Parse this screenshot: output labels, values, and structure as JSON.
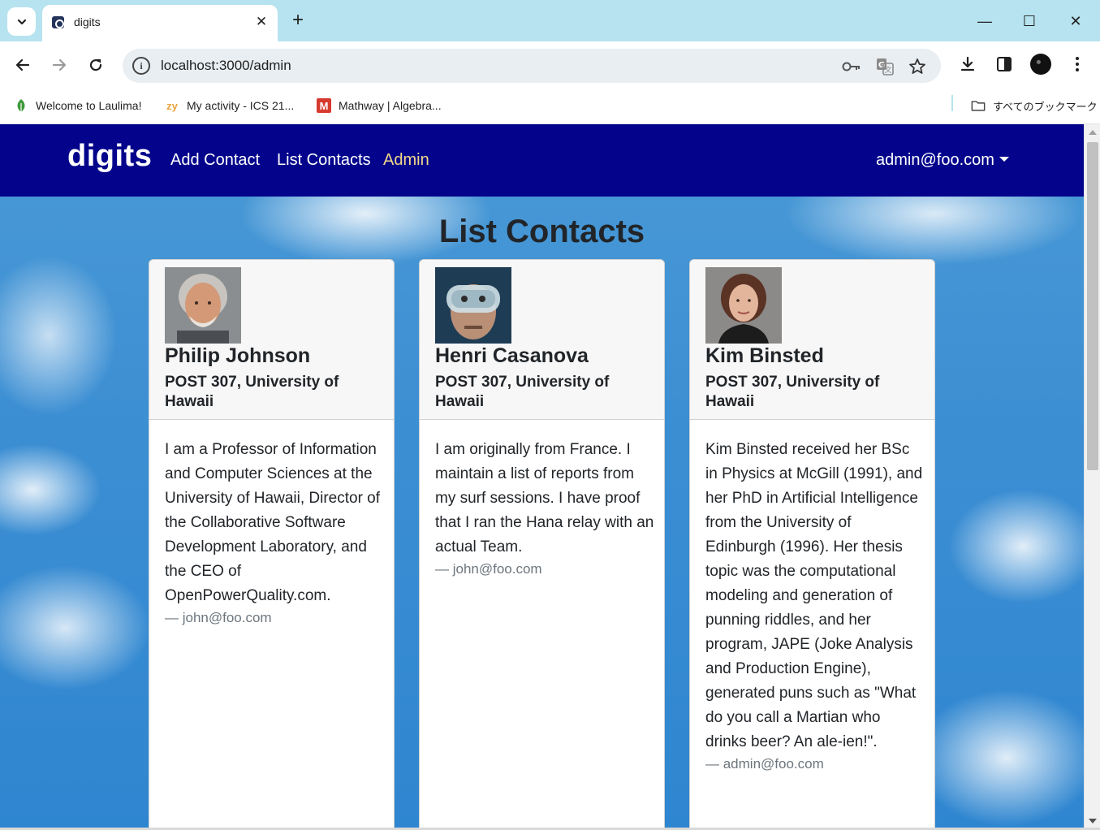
{
  "browser": {
    "tab_title": "digits",
    "tab_close": "✕",
    "new_tab": "+",
    "url": "localhost:3000/admin",
    "info_icon": "i",
    "window_controls": {
      "minimize": "—",
      "maximize": "☐",
      "close": "✕"
    },
    "bookmarks": [
      {
        "label": "Welcome to Laulima!",
        "icon": "leaf-icon"
      },
      {
        "label": "My activity - ICS 21...",
        "icon": "zy",
        "icon_color": "#e8a33d"
      },
      {
        "label": "Mathway | Algebra...",
        "icon": "M",
        "icon_color": "#d63a2f"
      }
    ],
    "all_bookmarks": "すべてのブックマーク"
  },
  "navbar": {
    "brand": "digits",
    "links": [
      "Add Contact",
      "List Contacts",
      "Admin"
    ],
    "active_link": "Admin",
    "user": "admin@foo.com",
    "background": "#03038b",
    "active_color": "#f5d98a"
  },
  "page": {
    "title": "List Contacts"
  },
  "contacts": [
    {
      "name": "Philip Johnson",
      "address": "POST 307, University of Hawaii",
      "description": "I am a Professor of Information and Computer Sciences at the University of Hawaii, Director of the Collaborative Software Development Laboratory, and the CEO of OpenPowerQuality.com.",
      "owner": "— john@foo.com"
    },
    {
      "name": "Henri Casanova",
      "address": "POST 307, University of Hawaii",
      "description": "I am originally from France. I maintain a list of reports from my surf sessions. I have proof that I ran the Hana relay with an actual Team.",
      "owner": "— john@foo.com"
    },
    {
      "name": "Kim Binsted",
      "address": "POST 307, University of Hawaii",
      "description": "Kim Binsted received her BSc in Physics at McGill (1991), and her PhD in Artificial Intelligence from the University of Edinburgh (1996). Her thesis topic was the computational modeling and generation of punning riddles, and her program, JAPE (Joke Analysis and Production Engine), generated puns such as \"What do you call a Martian who drinks beer? An ale-ien!\".",
      "owner": "— admin@foo.com"
    }
  ]
}
